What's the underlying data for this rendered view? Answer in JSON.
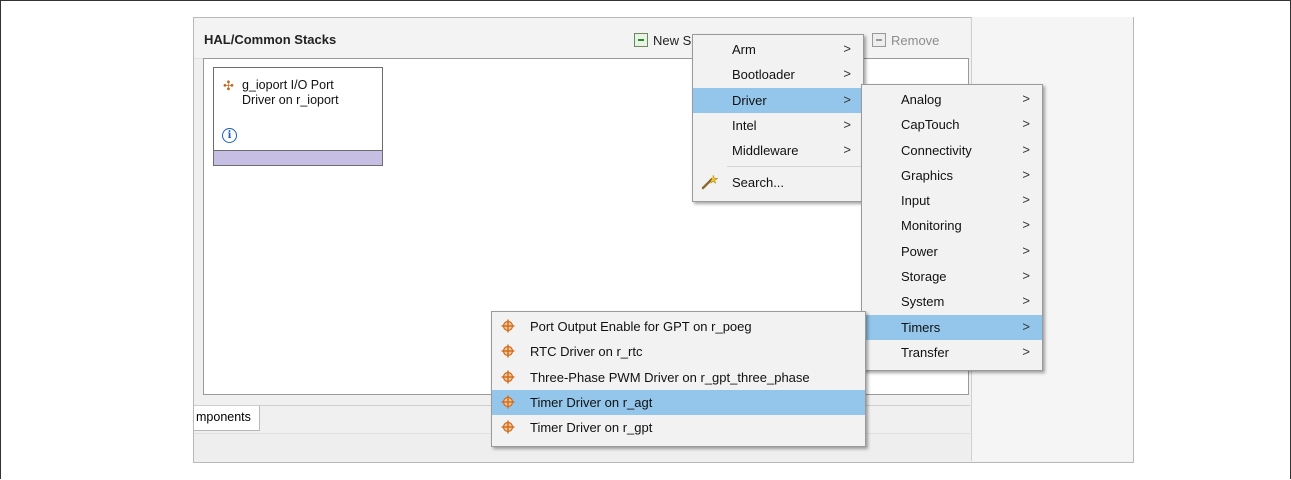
{
  "panel": {
    "title": "HAL/Common Stacks",
    "new_stack_label": "New S",
    "remove_label": "Remove"
  },
  "stack_block": {
    "line1": "g_ioport I/O Port",
    "line2": "Driver on r_ioport",
    "info_symbol": "i"
  },
  "bottom_tab": {
    "label": "mponents"
  },
  "new_stack_menu": {
    "items": [
      {
        "label": "Arm",
        "submenu": true,
        "selected": false
      },
      {
        "label": "Bootloader",
        "submenu": true,
        "selected": false
      },
      {
        "label": "Driver",
        "submenu": true,
        "selected": true
      },
      {
        "label": "Intel",
        "submenu": true,
        "selected": false
      },
      {
        "label": "Middleware",
        "submenu": true,
        "selected": false
      }
    ],
    "search_label": "Search...",
    "search_icon": "search-wand-icon"
  },
  "driver_menu": {
    "items": [
      {
        "label": "Analog"
      },
      {
        "label": "CapTouch"
      },
      {
        "label": "Connectivity"
      },
      {
        "label": "Graphics"
      },
      {
        "label": "Input"
      },
      {
        "label": "Monitoring"
      },
      {
        "label": "Power"
      },
      {
        "label": "Storage"
      },
      {
        "label": "System"
      },
      {
        "label": "Timers",
        "selected": true
      },
      {
        "label": "Transfer"
      }
    ]
  },
  "timers_menu": {
    "items": [
      {
        "label": "Port Output Enable for GPT on r_poeg"
      },
      {
        "label": "RTC Driver on r_rtc"
      },
      {
        "label": "Three-Phase PWM Driver on r_gpt_three_phase"
      },
      {
        "label": "Timer Driver on r_agt",
        "selected": true
      },
      {
        "label": "Timer Driver on r_gpt"
      }
    ],
    "item_icon": "component-crosshair-icon"
  },
  "colors": {
    "selection": "#93c6ea",
    "menu_bg": "#f2f2f2",
    "stack_bar": "#c7bfe3",
    "component_icon": "#d06a1c"
  },
  "arrow_glyph": ">"
}
